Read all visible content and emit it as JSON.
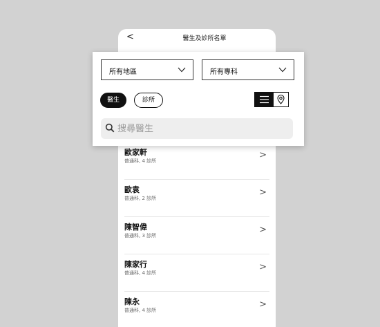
{
  "header": {
    "back_glyph": "<",
    "title": "醫生及診所名單"
  },
  "filters": {
    "region": {
      "value": "所有地區"
    },
    "specialty": {
      "value": "所有專科"
    }
  },
  "pills": {
    "doctor": "醫生",
    "clinic": "診所"
  },
  "search": {
    "placeholder": "搜尋醫生"
  },
  "doctors": [
    {
      "name": "歐家軒",
      "detail": "普通科, 4 診所"
    },
    {
      "name": "歐袁",
      "detail": "普通科, 2 診所"
    },
    {
      "name": "陳智偉",
      "detail": "普通科, 3 診所"
    },
    {
      "name": "陳家行",
      "detail": "普通科, 4 診所"
    },
    {
      "name": "陳永",
      "detail": "普通科, 4 診所"
    }
  ],
  "chevron_glyph": ">",
  "colors": {
    "background": "#d2d2d2",
    "accent": "#111111",
    "search_bg": "#eeeeee"
  },
  "icons": [
    "chevron-down-icon",
    "list-icon",
    "map-pin-icon",
    "search-icon"
  ]
}
